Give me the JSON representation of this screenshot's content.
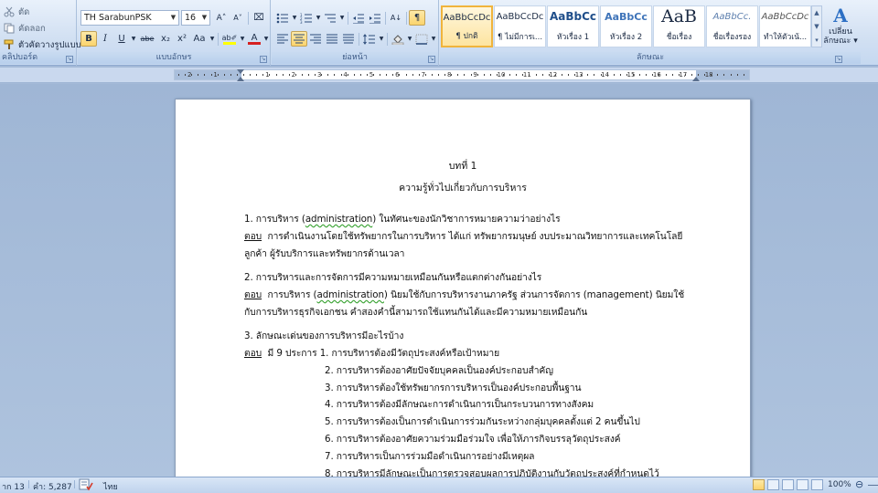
{
  "ribbon": {
    "clipboard": {
      "cut_label": "ตัด",
      "copy_label": "คัดลอก",
      "format_painter_label": "ตัวคัดวางรูปแบบ",
      "group_label": "คลิปบอร์ด"
    },
    "font": {
      "font_name": "TH SarabunPSK",
      "font_size": "16",
      "grow_font": "A˄",
      "shrink_font": "A˅",
      "clear_format": "⌧",
      "bold": "B",
      "italic": "I",
      "underline": "U",
      "strikethrough": "abe",
      "subscript": "x₂",
      "superscript": "x²",
      "change_case": "Aa",
      "highlight": "ab✐",
      "font_color": "A",
      "group_label": "แบบอักษร"
    },
    "paragraph": {
      "group_label": "ย่อหน้า",
      "show_marks": "¶",
      "sort": "A↓"
    },
    "styles": {
      "group_label": "ลักษณะ",
      "items": [
        {
          "preview": "AaBbCcDc",
          "name": "¶ ปกติ"
        },
        {
          "preview": "AaBbCcDc",
          "name": "¶ ไม่มีการเ..."
        },
        {
          "preview": "AaBbCc",
          "name": "หัวเรื่อง 1"
        },
        {
          "preview": "AaBbCc",
          "name": "หัวเรื่อง 2"
        },
        {
          "preview": "AaB",
          "name": "ชื่อเรื่อง"
        },
        {
          "preview": "AaBbCc.",
          "name": "ชื่อเรื่องรอง"
        },
        {
          "preview": "AaBbCcDc",
          "name": "ทำให้ตัวเน้..."
        }
      ],
      "change_styles_label_1": "เปลี่ยน",
      "change_styles_label_2": "ลักษณะ ▾",
      "change_styles_glyph": "A"
    }
  },
  "ruler": {
    "numbers_left": [
      "2",
      "1"
    ],
    "numbers_right": [
      "1",
      "2",
      "3",
      "4",
      "5",
      "6",
      "7",
      "8",
      "9",
      "10",
      "11",
      "12",
      "13",
      "14",
      "15",
      "16",
      "17",
      "18"
    ]
  },
  "document": {
    "chapter": "บทที่ 1",
    "subtitle": "ความรู้ทั่วไปเกี่ยวกับการบริหาร",
    "q1_prefix": "1. การบริหาร (",
    "q1_term": "administration",
    "q1_suffix": ") ในทัศนะของนักวิชาการหมายความว่าอย่างไร",
    "answer_label": "ตอบ",
    "a1_line1": "การดำเนินงานโดยใช้ทรัพยากรในการบริหาร ได้แก่ ทรัพยากรมนุษย์ งบประมาณวิทยาการและเทคโนโลยี",
    "a1_line2": "ลูกค้า ผู้รับบริการและทรัพยากรด้านเวลา",
    "q2": "2. การบริหารและการจัดการมีความหมายเหมือนกันหรือแตกต่างกันอย่างไร",
    "a2_prefix": "การบริหาร (",
    "a2_term": "administration",
    "a2_suffix": ") นิยมใช้กับการบริหารงานภาครัฐ ส่วนการจัดการ (management) นิยมใช้",
    "a2_line2": "กับการบริหารธุรกิจเอกชน คำสองคำนี้สามารถใช้แทนกันได้และมีความหมายเหมือนกัน",
    "q3": "3. ลักษณะเด่นของการบริหารมีอะไรบ้าง",
    "a3_intro": "มี 9 ประการ",
    "a3_items": [
      "1. การบริหารต้องมีวัตถุประสงค์หรือเป้าหมาย",
      "2. การบริหารต้องอาศัยปัจจัยบุคคลเป็นองค์ประกอบสำคัญ",
      "3. การบริหารต้องใช้ทรัพยากรการบริหารเป็นองค์ประกอบพื้นฐาน",
      "4. การบริหารต้องมีลักษณะการดำเนินการเป็นกระบวนการทางสังคม",
      "5. การบริหารต้องเป็นการดำเนินการร่วมกันระหว่างกลุ่มบุคคลตั้งแต่ 2 คนขึ้นไป",
      "6. การบริหารต้องอาศัยความร่วมมือร่วมใจ เพื่อให้ภารกิจบรรลุวัตถุประสงค์",
      "7. การบริหารเป็นการร่วมมือดำเนินการอย่างมีเหตุผล",
      "8. การบริหารมีลักษณะเป็นการตรวจสอบผลการปฏิบัติงานกับวัตถุประสงค์ที่กำหนดไว้"
    ]
  },
  "status": {
    "page": "าก 13",
    "words": "คำ: 5,287",
    "language": "ไทย",
    "zoom": "100%"
  },
  "colors": {
    "highlight": "#ffff00",
    "font_color": "#d62020",
    "accent": "#f0b43c"
  }
}
